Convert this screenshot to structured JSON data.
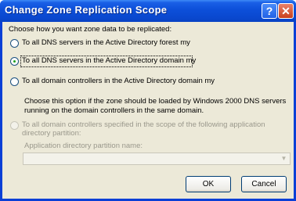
{
  "window": {
    "title": "Change Zone Replication Scope"
  },
  "titlebar_buttons": {
    "help": "?",
    "close": "✕"
  },
  "prompt": "Choose how you want zone data to be replicated:",
  "options": [
    {
      "label": "To all DNS servers in the Active Directory forest my",
      "selected": false,
      "enabled": true
    },
    {
      "label": "To all DNS servers in the Active Directory domain my",
      "selected": true,
      "enabled": true
    },
    {
      "label": "To all domain controllers in the Active Directory domain my",
      "selected": false,
      "enabled": true
    },
    {
      "label": "To all domain controllers specified in the scope of the following application directory partition:",
      "selected": false,
      "enabled": false
    }
  ],
  "description": {
    "line1": "Choose this option if the zone should be loaded by Windows 2000 DNS servers",
    "line2": "running on the domain controllers in the same domain."
  },
  "partition": {
    "label": "Application directory partition name:",
    "value": ""
  },
  "buttons": {
    "ok": "OK",
    "cancel": "Cancel"
  }
}
